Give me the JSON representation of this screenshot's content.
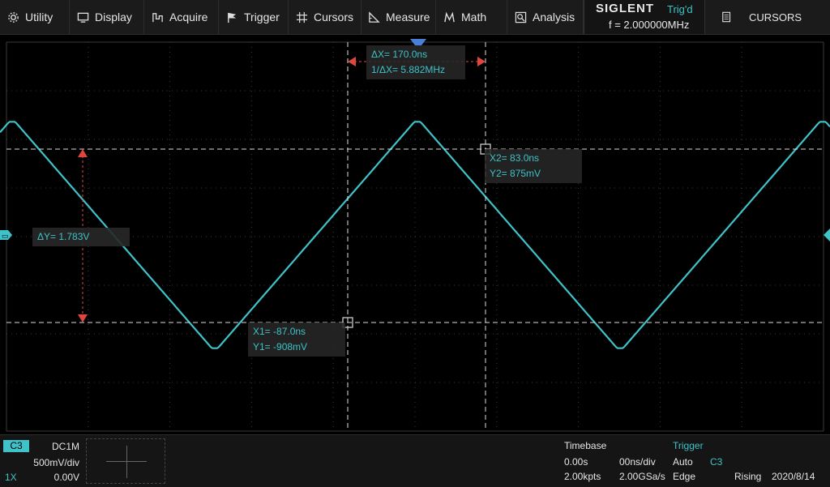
{
  "menu": {
    "items": [
      {
        "label": "Utility",
        "icon": "gear-icon"
      },
      {
        "label": "Display",
        "icon": "monitor-icon"
      },
      {
        "label": "Acquire",
        "icon": "acquire-icon"
      },
      {
        "label": "Trigger",
        "icon": "flag-icon"
      },
      {
        "label": "Cursors",
        "icon": "crosshair-icon"
      },
      {
        "label": "Measure",
        "icon": "ruler-icon"
      },
      {
        "label": "Math",
        "icon": "math-icon"
      },
      {
        "label": "Analysis",
        "icon": "analysis-icon"
      }
    ]
  },
  "status": {
    "brand": "SIGLENT",
    "trigger_state": "Trig'd",
    "frequency": "f = 2.000000MHz",
    "panel": "CURSORS"
  },
  "cursors": {
    "delta_x": "ΔX= 170.0ns",
    "inv_delta_x": "1/ΔX= 5.882MHz",
    "delta_y": "ΔY= 1.783V",
    "x1": "X1= -87.0ns",
    "y1": "Y1= -908mV",
    "x2": "X2= 83.0ns",
    "y2": "Y2= 875mV"
  },
  "colors": {
    "trace": "#3fc2c8",
    "cursor_marker": "#e0463e",
    "trigger_pointer": "#4a7fd8",
    "grid": "#3a3a3a"
  },
  "channel": {
    "name": "C3",
    "coupling": "DC1M",
    "scale": "500mV/div",
    "probe": "1X",
    "offset": "0.00V"
  },
  "timebase": {
    "title": "Timebase",
    "delay": "0.00s",
    "scale": "00ns/div",
    "memory": "2.00kpts",
    "sample_rate": "2.00GSa/s"
  },
  "trigger": {
    "label": "Trigger",
    "mode": "Auto",
    "source": "C3",
    "type": "Edge",
    "slope": "Rising",
    "date": "2020/8/14"
  }
}
